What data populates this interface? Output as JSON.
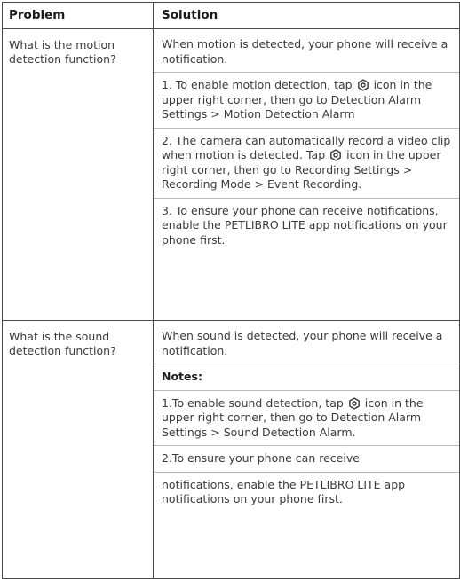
{
  "header": {
    "problem": "Problem",
    "solution": "Solution"
  },
  "rows": [
    {
      "question": "What is the motion detection function?",
      "paragraphs": [
        {
          "text": "When motion is detected, your phone will receive a notification."
        },
        {
          "before": "1. To enable motion detection, tap",
          "after": "icon in the upper right corner, then go to Detection Alarm Settings > Motion Detection Alarm"
        },
        {
          "before": "2. The camera can automatically record a video clip when motion is detected. Tap",
          "after": "icon in the upper right corner, then go to Recording Settings > Recording Mode > Event Recording."
        },
        {
          "text": "3. To ensure your phone can receive notifications, enable the PETLIBRO LITE app notifications on your phone first."
        }
      ]
    },
    {
      "question": "What is the sound detection function?",
      "paragraphs": [
        {
          "text": "When sound is detected, your phone will receive a notification."
        },
        {
          "text": "Notes:"
        },
        {
          "before": "1.To enable sound detection, tap",
          "after": "icon in the upper right corner, then go to Detection Alarm Settings > Sound Detection Alarm."
        },
        {
          "text": "2.To ensure your phone can receive"
        },
        {
          "text": "notifications, enable the PETLIBRO LITE app notifications on your phone first."
        }
      ]
    }
  ]
}
